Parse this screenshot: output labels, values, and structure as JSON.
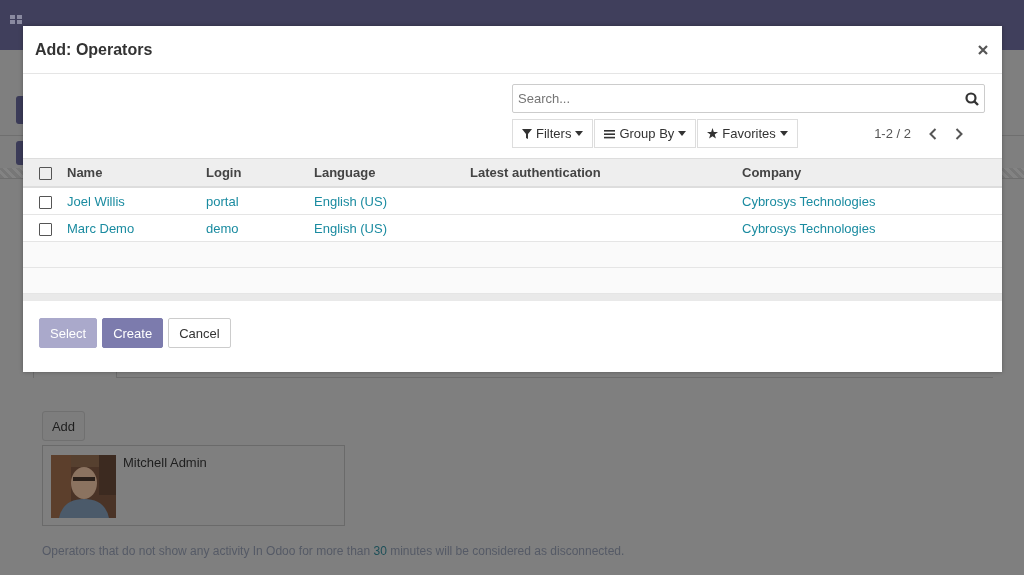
{
  "page": {
    "add_button": "Add",
    "operators": [
      {
        "name": "Mitchell Admin",
        "kind": "picture"
      }
    ],
    "note": {
      "before": "Operators that do not show any activity In Odoo for more than ",
      "highlight": "30",
      "after": " minutes will be considered as disconnected."
    }
  },
  "dialog": {
    "title": "Add: Operators",
    "search": {
      "placeholder": "Search..."
    },
    "search_buttons": [
      {
        "label": "Filters",
        "kind": "filter"
      },
      {
        "label": "Group By",
        "kind": "list"
      },
      {
        "label": "Favorites",
        "kind": "star"
      }
    ],
    "pager": "1-2 / 2",
    "table": {
      "header_checked": false,
      "columns": [
        "Name",
        "Login",
        "Language",
        "Latest authentication",
        "Company"
      ],
      "rows": [
        {
          "checked": false,
          "name": "Joel Willis",
          "login": "portal",
          "language": "English (US)",
          "company": "Cybrosys Technologies"
        },
        {
          "checked": false,
          "name": "Marc Demo",
          "login": "demo",
          "language": "English (US)",
          "company": "Cybrosys Technologies"
        }
      ]
    },
    "buttons": [
      {
        "label": "Select",
        "kind": "primary",
        "disabled": true
      },
      {
        "label": "Create",
        "kind": "primary",
        "disabled": false
      },
      {
        "label": "Cancel",
        "kind": "secondary",
        "disabled": false
      }
    ]
  }
}
